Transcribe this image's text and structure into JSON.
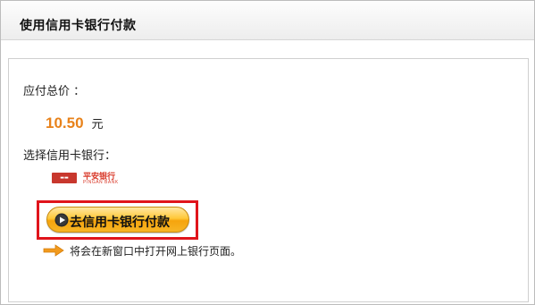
{
  "header": {
    "title": "使用信用卡银行付款"
  },
  "payment": {
    "total_label": "应付总价 ：",
    "amount": "10.50",
    "currency": "元",
    "choose_bank_label": "选择信用卡银行：",
    "bank_logo": {
      "icon": "ping-an-bank-logo",
      "name": "平安银行",
      "name_en": "PINGAN BANK"
    },
    "go_button_label": "去信用卡银行付款",
    "note": "将会在新窗口中打开网上银行页面。"
  },
  "colors": {
    "amount": "#e8821a",
    "highlight": "#e0141b",
    "button": "#ffc838",
    "arrow": "#f29a1d"
  }
}
